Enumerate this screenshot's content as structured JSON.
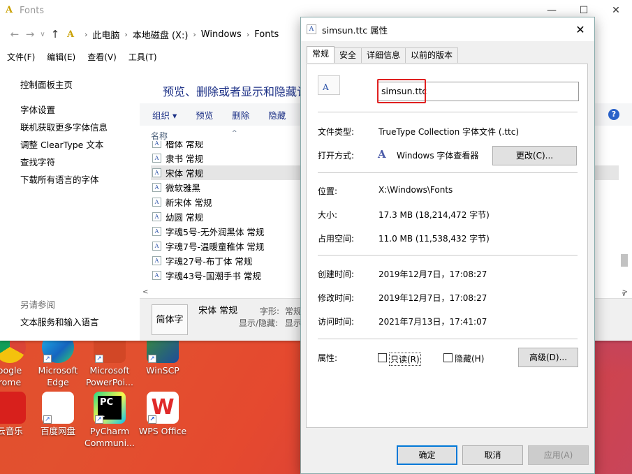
{
  "explorer": {
    "title": "Fonts",
    "controls": {
      "minimize": "—",
      "maximize": "☐",
      "close": "✕"
    },
    "breadcrumb": [
      "此电脑",
      "本地磁盘 (X:)",
      "Windows",
      "Fonts"
    ],
    "menu": [
      "文件(F)",
      "编辑(E)",
      "查看(V)",
      "工具(T)"
    ],
    "left_links": [
      "控制面板主页",
      "字体设置",
      "联机获取更多字体信息",
      "调整 ClearType 文本",
      "查找字符",
      "下载所有语言的字体"
    ],
    "see_also_title": "另请参阅",
    "see_also_links": [
      "文本服务和输入语言"
    ],
    "heading": "预览、删除或者显示和隐藏计",
    "toolbar": [
      "组织 ▾",
      "预览",
      "删除",
      "隐藏"
    ],
    "column_name": "名称",
    "fonts": [
      "楷体 常规",
      "隶书 常规",
      "宋体 常规",
      "微软雅黑",
      "新宋体 常规",
      "幼圆 常规",
      "字魂5号-无外润黑体 常规",
      "字魂7号-温暖童稚体 常规",
      "字魂27号-布丁体 常规",
      "字魂43号-国潮手书 常规"
    ],
    "preview": {
      "sample": "简体字",
      "name": "宋体 常规",
      "key1": "字形:",
      "val1": "常规",
      "key2": "显示/隐藏:",
      "val2": "显示"
    }
  },
  "desktop": {
    "icons": [
      {
        "label": "Google Chrome",
        "l1": "oogle",
        "l2": "rome"
      },
      {
        "label": "Microsoft Edge",
        "l1": "Microsoft",
        "l2": "Edge"
      },
      {
        "label": "Microsoft PowerPoint",
        "l1": "Microsoft",
        "l2": "PowerPoi..."
      },
      {
        "label": "WinSCP",
        "l1": "WinSCP",
        "l2": ""
      },
      {
        "label": "网易云音乐",
        "l1": "云音乐",
        "l2": ""
      },
      {
        "label": "百度网盘",
        "l1": "百度网盘",
        "l2": ""
      },
      {
        "label": "PyCharm Community",
        "l1": "PyCharm",
        "l2": "Communi..."
      },
      {
        "label": "WPS Office",
        "l1": "WPS Office",
        "l2": ""
      }
    ]
  },
  "dialog": {
    "title": "simsun.ttc 属性",
    "tabs": [
      "常规",
      "安全",
      "详细信息",
      "以前的版本"
    ],
    "filename": "simsun.ttc",
    "file_type_label": "文件类型:",
    "file_type_value": "TrueType Collection 字体文件 (.ttc)",
    "open_with_label": "打开方式:",
    "open_with_value": "Windows 字体查看器",
    "change_button": "更改(C)...",
    "location_label": "位置:",
    "location_value": "X:\\Windows\\Fonts",
    "size_label": "大小:",
    "size_value": "17.3 MB (18,214,472 字节)",
    "disk_label": "占用空间:",
    "disk_value": "11.0 MB (11,538,432 字节)",
    "created_label": "创建时间:",
    "created_value": "2019年12月7日，17:08:27",
    "modified_label": "修改时间:",
    "modified_value": "2019年12月7日，17:08:27",
    "accessed_label": "访问时间:",
    "accessed_value": "2021年7月13日，17:41:07",
    "attributes_label": "属性:",
    "readonly_label": "只读(R)",
    "hidden_label": "隐藏(H)",
    "advanced_button": "高级(D)...",
    "ok_button": "确定",
    "cancel_button": "取消",
    "apply_button": "应用(A)"
  }
}
